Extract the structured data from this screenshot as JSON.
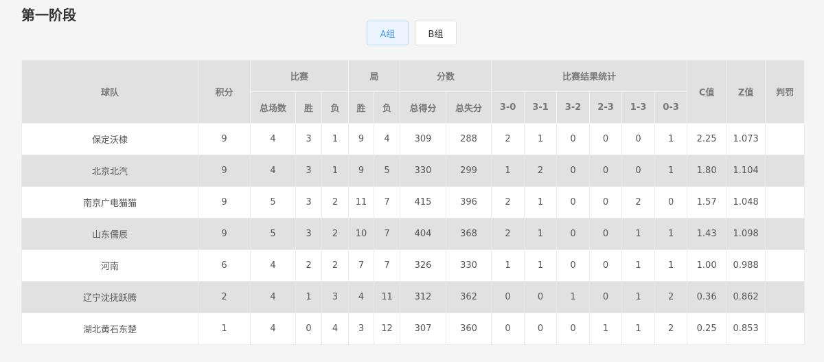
{
  "page": {
    "title": "第一阶段"
  },
  "tabs": [
    {
      "label": "A组",
      "active": true
    },
    {
      "label": "B组",
      "active": false
    }
  ],
  "table": {
    "headers": {
      "team": "球队",
      "points": "积分",
      "matches": "比赛",
      "sets": "局",
      "scores": "分数",
      "results": "比赛结果统计",
      "c": "C值",
      "z": "Z值",
      "penalty": "判罚",
      "matches_total": "总场数",
      "matches_win": "胜",
      "matches_loss": "负",
      "sets_win": "胜",
      "sets_loss": "负",
      "score_for": "总得分",
      "score_against": "总失分",
      "r30": "3-0",
      "r31": "3-1",
      "r32": "3-2",
      "r23": "2-3",
      "r13": "1-3",
      "r03": "0-3"
    },
    "rows": [
      [
        "保定沃棣",
        "9",
        "4",
        "3",
        "1",
        "9",
        "4",
        "309",
        "288",
        "2",
        "1",
        "0",
        "0",
        "0",
        "1",
        "2.25",
        "1.073",
        ""
      ],
      [
        "北京北汽",
        "9",
        "4",
        "3",
        "1",
        "9",
        "5",
        "330",
        "299",
        "1",
        "2",
        "0",
        "0",
        "0",
        "1",
        "1.80",
        "1.104",
        ""
      ],
      [
        "南京广电猫猫",
        "9",
        "5",
        "3",
        "2",
        "11",
        "7",
        "415",
        "396",
        "2",
        "1",
        "0",
        "0",
        "2",
        "0",
        "1.57",
        "1.048",
        ""
      ],
      [
        "山东儒辰",
        "9",
        "5",
        "3",
        "2",
        "10",
        "7",
        "404",
        "368",
        "2",
        "1",
        "0",
        "0",
        "1",
        "1",
        "1.43",
        "1.098",
        ""
      ],
      [
        "河南",
        "6",
        "4",
        "2",
        "2",
        "7",
        "7",
        "326",
        "330",
        "1",
        "1",
        "0",
        "0",
        "1",
        "1",
        "1.00",
        "0.988",
        ""
      ],
      [
        "辽宁沈抚跃腾",
        "2",
        "4",
        "1",
        "3",
        "4",
        "11",
        "312",
        "362",
        "0",
        "0",
        "1",
        "0",
        "1",
        "2",
        "0.36",
        "0.862",
        ""
      ],
      [
        "湖北黄石东楚",
        "1",
        "4",
        "0",
        "4",
        "3",
        "12",
        "307",
        "360",
        "0",
        "0",
        "0",
        "1",
        "1",
        "2",
        "0.25",
        "0.853",
        ""
      ]
    ]
  }
}
